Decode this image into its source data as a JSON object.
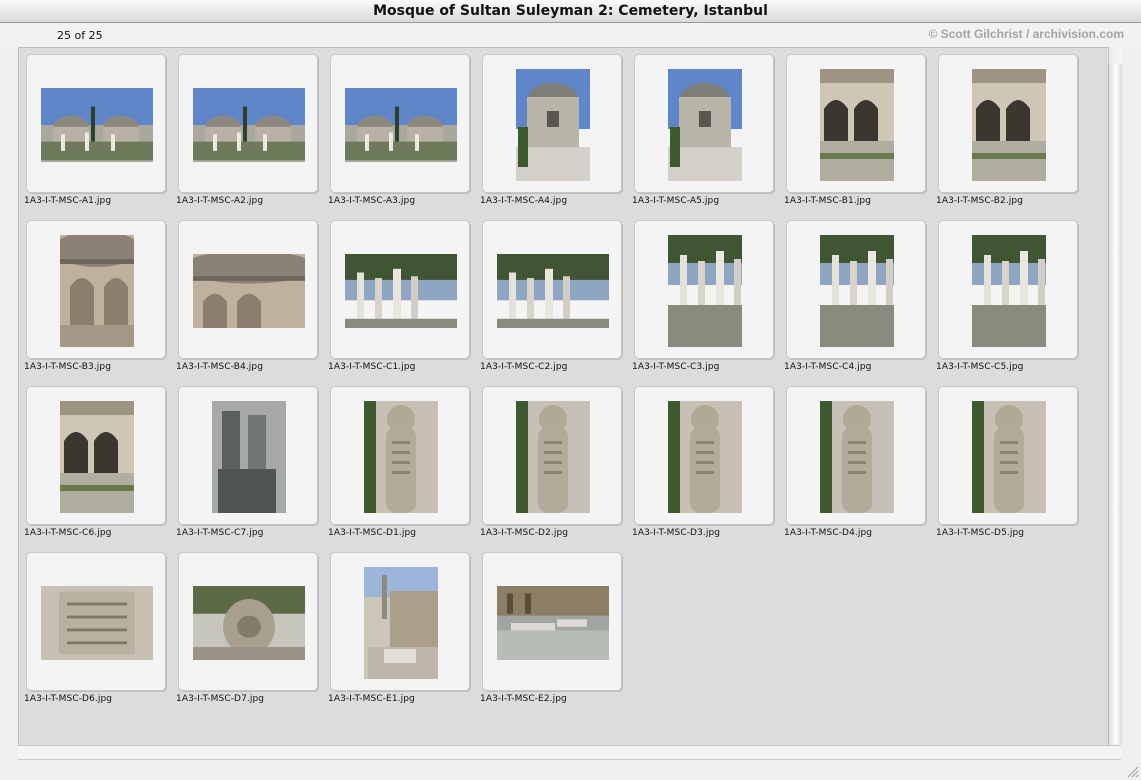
{
  "window": {
    "title": "Mosque of Sultan Suleyman 2: Cemetery, Istanbul"
  },
  "header": {
    "count": "25 of 25",
    "credit": "© Scott Gilchrist / archivision.com"
  },
  "colors": {
    "panel": "#dcdcdc",
    "card": "#f4f4f4",
    "sky": "#5e86c8",
    "stone": "#c2b8a6",
    "foliage": "#3e5a2f"
  },
  "images": [
    {
      "name": "1A3-I-T-MSC-A1.jpg",
      "orientation": "landscape",
      "kind": "domes"
    },
    {
      "name": "1A3-I-T-MSC-A2.jpg",
      "orientation": "landscape",
      "kind": "domes"
    },
    {
      "name": "1A3-I-T-MSC-A3.jpg",
      "orientation": "landscape",
      "kind": "domes"
    },
    {
      "name": "1A3-I-T-MSC-A4.jpg",
      "orientation": "portrait",
      "kind": "tomb"
    },
    {
      "name": "1A3-I-T-MSC-A5.jpg",
      "orientation": "portrait",
      "kind": "tomb"
    },
    {
      "name": "1A3-I-T-MSC-B1.jpg",
      "orientation": "portrait",
      "kind": "arcade"
    },
    {
      "name": "1A3-I-T-MSC-B2.jpg",
      "orientation": "portrait",
      "kind": "arcade"
    },
    {
      "name": "1A3-I-T-MSC-B3.jpg",
      "orientation": "portrait",
      "kind": "wall"
    },
    {
      "name": "1A3-I-T-MSC-B4.jpg",
      "orientation": "landscape",
      "kind": "wall"
    },
    {
      "name": "1A3-I-T-MSC-C1.jpg",
      "orientation": "landscape",
      "kind": "graves"
    },
    {
      "name": "1A3-I-T-MSC-C2.jpg",
      "orientation": "landscape",
      "kind": "graves"
    },
    {
      "name": "1A3-I-T-MSC-C3.jpg",
      "orientation": "portrait",
      "kind": "graves"
    },
    {
      "name": "1A3-I-T-MSC-C4.jpg",
      "orientation": "portrait",
      "kind": "graves"
    },
    {
      "name": "1A3-I-T-MSC-C5.jpg",
      "orientation": "portrait",
      "kind": "graves"
    },
    {
      "name": "1A3-I-T-MSC-C6.jpg",
      "orientation": "portrait",
      "kind": "arcade"
    },
    {
      "name": "1A3-I-T-MSC-C7.jpg",
      "orientation": "portrait",
      "kind": "monument"
    },
    {
      "name": "1A3-I-T-MSC-D1.jpg",
      "orientation": "portrait",
      "kind": "stele"
    },
    {
      "name": "1A3-I-T-MSC-D2.jpg",
      "orientation": "portrait",
      "kind": "stele"
    },
    {
      "name": "1A3-I-T-MSC-D3.jpg",
      "orientation": "portrait",
      "kind": "stele"
    },
    {
      "name": "1A3-I-T-MSC-D4.jpg",
      "orientation": "portrait",
      "kind": "stele"
    },
    {
      "name": "1A3-I-T-MSC-D5.jpg",
      "orientation": "portrait",
      "kind": "stele"
    },
    {
      "name": "1A3-I-T-MSC-D6.jpg",
      "orientation": "landscape",
      "kind": "inscription"
    },
    {
      "name": "1A3-I-T-MSC-D7.jpg",
      "orientation": "landscape",
      "kind": "carving"
    },
    {
      "name": "1A3-I-T-MSC-E1.jpg",
      "orientation": "portrait",
      "kind": "street"
    },
    {
      "name": "1A3-I-T-MSC-E2.jpg",
      "orientation": "landscape",
      "kind": "bench"
    }
  ]
}
